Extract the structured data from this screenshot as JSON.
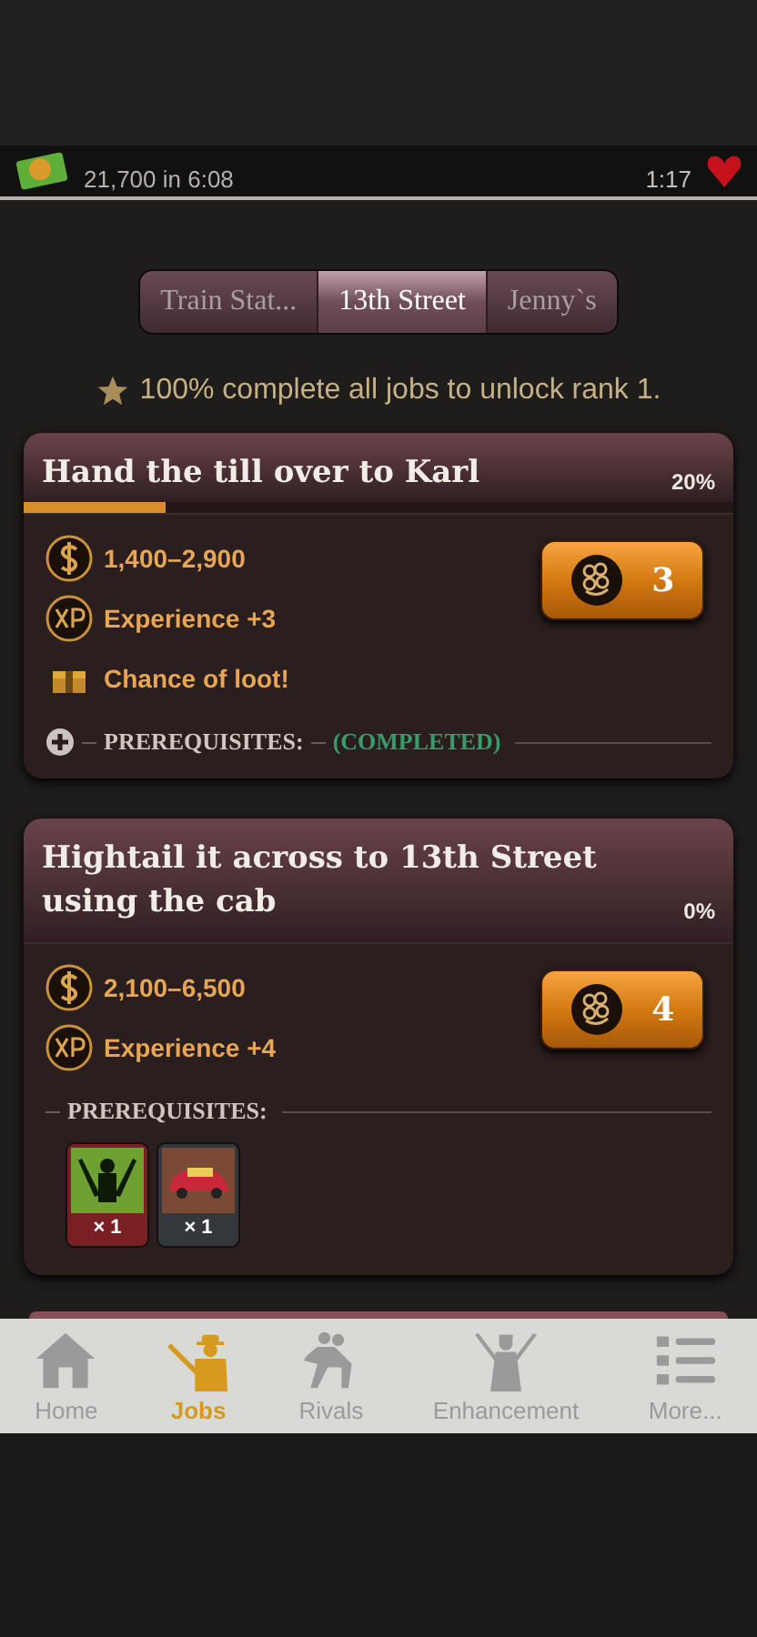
{
  "status": {
    "income": "21,700 in 6:08",
    "timer": "1:17"
  },
  "tabs": [
    {
      "label": "Train Stat...",
      "selected": false
    },
    {
      "label": "13th Street",
      "selected": true
    },
    {
      "label": "Jenny`s",
      "selected": false
    }
  ],
  "rank_note": "100% complete all jobs to unlock rank 1.",
  "jobs": [
    {
      "title": "Hand the till over to Karl",
      "percent": "20%",
      "level": 0.2,
      "rewards": [
        {
          "kind": "cash",
          "text": "1,400–2,900"
        },
        {
          "kind": "xp",
          "text": "Experience +3"
        },
        {
          "kind": "loot",
          "text": "Chance of loot!"
        }
      ],
      "energy": "3",
      "prerequisites": {
        "label": "PREREQUISITES:",
        "expanded": false,
        "status": "(COMPLETED)"
      }
    },
    {
      "title": "Hightail it across to 13th Street using the cab",
      "percent": "0%",
      "rewards": [
        {
          "kind": "cash",
          "text": "2,100–6,500"
        },
        {
          "kind": "xp",
          "text": "Experience +4"
        }
      ],
      "energy": "4",
      "prerequisites": {
        "label": "PREREQUISITES:",
        "expanded": true,
        "items": [
          {
            "kind": "gunman",
            "count": "× 1",
            "color": "#7a1f24"
          },
          {
            "kind": "car",
            "count": "× 1",
            "color": "#34373c"
          }
        ]
      }
    }
  ],
  "nav": [
    {
      "label": "Home",
      "selected": false,
      "kind": "home"
    },
    {
      "label": "Jobs",
      "selected": true,
      "kind": "jobs"
    },
    {
      "label": "Rivals",
      "selected": false,
      "kind": "rivals"
    },
    {
      "label": "Enhancement",
      "selected": false,
      "kind": "enhancement"
    },
    {
      "label": "More...",
      "selected": false,
      "kind": "more"
    }
  ]
}
